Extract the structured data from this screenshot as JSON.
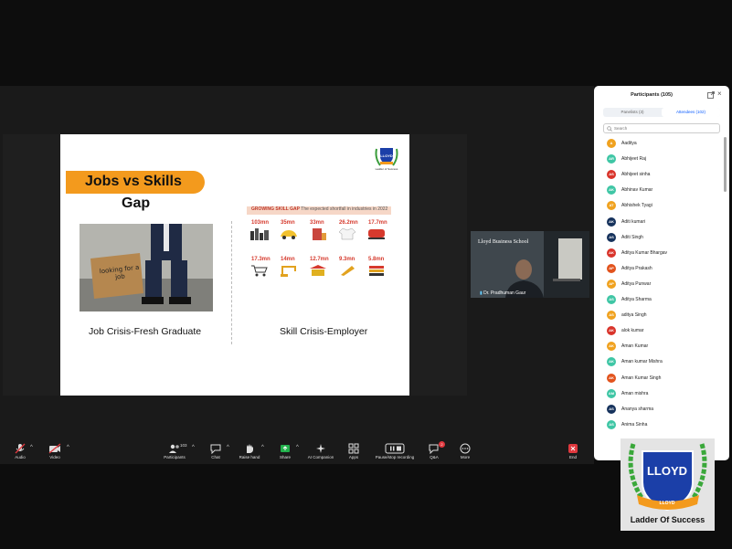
{
  "slide": {
    "title": "Jobs vs Skills",
    "subtitle": "Gap",
    "photo_sign": "looking for a job",
    "caption_left": "Job Crisis-Fresh Graduate",
    "caption_right": "Skill Crisis-Employer",
    "logo_text": "LLOYD",
    "logo_tag": "Ladder of Success",
    "infographic": {
      "heading": "GROWING SKILL GAP",
      "subheading": "The expected shortfall in industries in 2022",
      "metrics": [
        "103mn",
        "35mn",
        "33mn",
        "26.2mn",
        "17.7mn",
        "17.3mn",
        "14mn",
        "12.7mn",
        "9.3mn",
        "5.8mn"
      ]
    }
  },
  "video": {
    "name": "Dr. Pradhuman Gaur",
    "background_text": "Lloyd Business School"
  },
  "toolbar": {
    "audio": "Audio",
    "video": "Video",
    "participants": "Participants",
    "participants_count": "103",
    "chat": "Chat",
    "raise_hand": "Raise hand",
    "share": "Share",
    "ai_companion": "AI Companion",
    "apps": "Apps",
    "recording": "Pause/stop recording",
    "qa": "Q&A",
    "qa_badge": "2",
    "more": "More",
    "end": "End"
  },
  "panel": {
    "title": "Participants (105)",
    "tab_panelists": "Panelists (3)",
    "tab_attendees": "Attendees (102)",
    "search_placeholder": "Search",
    "attendees": [
      {
        "initials": "A",
        "name": "Aaditya",
        "color": "#f0a21f"
      },
      {
        "initials": "AR",
        "name": "Abhijeet Raj",
        "color": "#3fc6a5"
      },
      {
        "initials": "AS",
        "name": "Abhijeet sinha",
        "color": "#d9342b"
      },
      {
        "initials": "AK",
        "name": "Abhinav Kumar",
        "color": "#3fc6a5"
      },
      {
        "initials": "AT",
        "name": "Abhishek Tyagi",
        "color": "#f0a21f"
      },
      {
        "initials": "AK",
        "name": "Aditi kumari",
        "color": "#16325c"
      },
      {
        "initials": "AS",
        "name": "Aditi Singh",
        "color": "#16325c"
      },
      {
        "initials": "AK",
        "name": "Aditya Kumar Bhargav",
        "color": "#d9342b"
      },
      {
        "initials": "AP",
        "name": "Aditya Prakash",
        "color": "#e2531d"
      },
      {
        "initials": "AP",
        "name": "Aditya Punwar",
        "color": "#f0a21f"
      },
      {
        "initials": "AS",
        "name": "Aditya Sharma",
        "color": "#3fc6a5"
      },
      {
        "initials": "AS",
        "name": "aditya Singh",
        "color": "#f0a21f"
      },
      {
        "initials": "AK",
        "name": "alok kumar",
        "color": "#d9342b"
      },
      {
        "initials": "AK",
        "name": "Aman Kumar",
        "color": "#f0a21f"
      },
      {
        "initials": "AK",
        "name": "Aman kumar Mishra",
        "color": "#3fc6a5"
      },
      {
        "initials": "AK",
        "name": "Aman Kumar Singh",
        "color": "#e2531d"
      },
      {
        "initials": "AM",
        "name": "Aman mishra",
        "color": "#3fc6a5"
      },
      {
        "initials": "AS",
        "name": "Ananya sharma",
        "color": "#16325c"
      },
      {
        "initials": "AS",
        "name": "Anima Sinha",
        "color": "#3fc6a5"
      }
    ]
  },
  "watermark": {
    "brand": "LLOYD",
    "tagline": "Ladder Of Success"
  },
  "colors": {
    "accent": "#0b5cff",
    "banner": "#f39a1d",
    "end": "#e0383e"
  }
}
